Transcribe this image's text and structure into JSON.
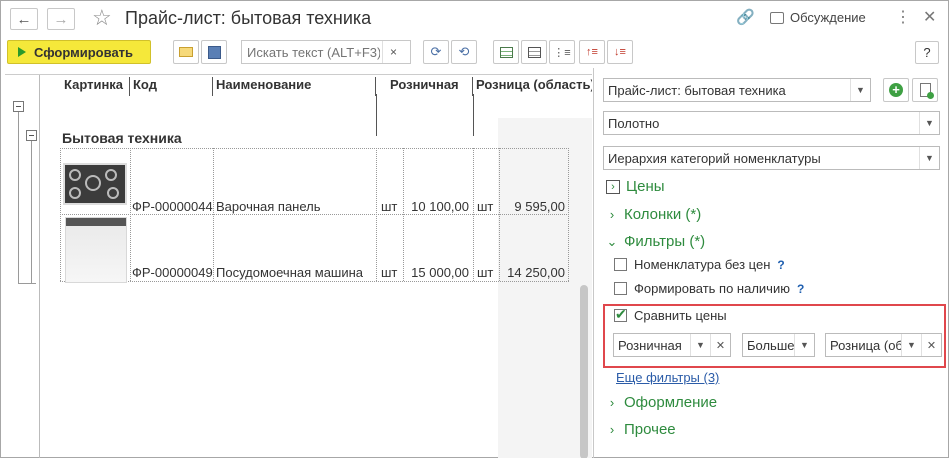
{
  "titlebar": {
    "back_icon": "arrow-left-icon",
    "forward_icon": "arrow-right-icon",
    "favorite_icon": "star-icon",
    "title": "Прайс-лист: бытовая техника",
    "link_icon": "link-icon",
    "discussion_label": "Обсуждение",
    "menu_glyph": "⋮",
    "close_glyph": "✕"
  },
  "toolbar": {
    "generate_label": "Сформировать",
    "search_placeholder": "Искать текст (ALT+F3)",
    "search_clear": "×",
    "help_label": "?"
  },
  "report": {
    "columns": [
      "Картинка",
      "Код",
      "Наименование",
      "Розничная",
      "Розница (область)"
    ],
    "group_title": "Бытовая техника",
    "rows": [
      {
        "image": "hob-image",
        "code": "ФР-00000044",
        "name": "Варочная панель",
        "unit1": "шт",
        "retail": "10 100,00",
        "unit2": "шт",
        "retail_region": "9 595,00"
      },
      {
        "image": "dishwasher-image",
        "code": "ФР-00000049",
        "name": "Посудомоечная машина",
        "unit1": "шт",
        "retail": "15 000,00",
        "unit2": "шт",
        "retail_region": "14 250,00"
      }
    ]
  },
  "panel": {
    "report_variant": "Прайс-лист: бытовая техника",
    "layout": "Полотно",
    "hierarchy": "Иерархия категорий номенклатуры",
    "sections": {
      "prices": "Цены",
      "columns": "Колонки (*)",
      "filters": "Фильтры (*)",
      "appearance": "Оформление",
      "other": "Прочее"
    },
    "filters": {
      "no_prices_label": "Номенклатура без цен",
      "no_prices_checked": false,
      "by_stock_label": "Формировать по наличию",
      "by_stock_checked": false,
      "compare_label": "Сравнить цены",
      "compare_checked": true,
      "compare_left": "Розничная",
      "compare_op": "Больше",
      "compare_right": "Розница (об",
      "help_mark": "?"
    },
    "more_filters": "Еще фильтры (3)"
  },
  "colors": {
    "accent_green": "#2e8b3e",
    "generate_yellow": "#f5e83a",
    "highlight_red": "#e0474c",
    "link_blue": "#2b5ca8"
  }
}
